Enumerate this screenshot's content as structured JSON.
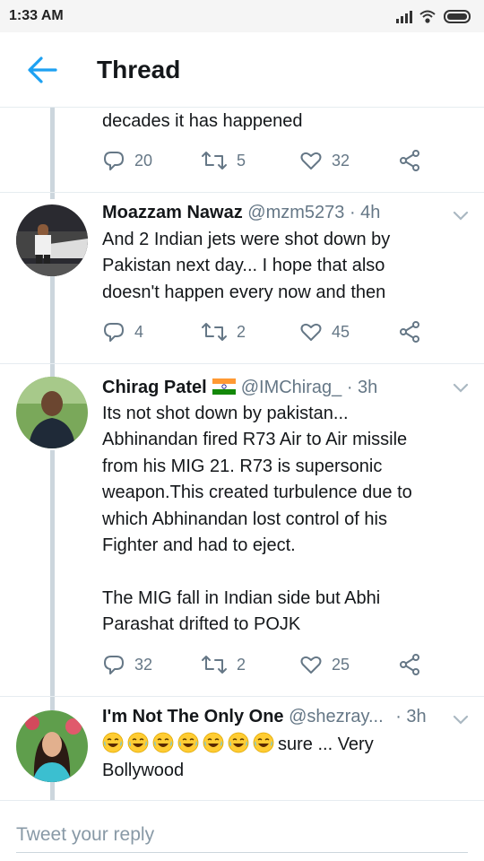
{
  "status_bar": {
    "time": "1:33 AM"
  },
  "header": {
    "title": "Thread"
  },
  "tweets": [
    {
      "text_tail": "decades it has happened",
      "replies": "20",
      "retweets": "5",
      "likes": "32"
    },
    {
      "name": "Moazzam Nawaz",
      "handle": "@mzm5273",
      "time": "· 4h",
      "lines": [
        "And 2 Indian jets were shot down by",
        "Pakistan next day... I hope that also",
        "doesn't happen every now and then"
      ],
      "replies": "4",
      "retweets": "2",
      "likes": "45"
    },
    {
      "name": "Chirag Patel",
      "handle": "@IMChirag_",
      "time": "· 3h",
      "lines": [
        "Its not shot down by pakistan...",
        "Abhinandan fired R73 Air to Air missile",
        "from his MIG 21. R73 is supersonic",
        "weapon.This created turbulence due to",
        "which Abhinandan lost control of his",
        "Fighter and had to eject.",
        "",
        "The MIG fall in Indian side but Abhi",
        "Parashat drifted to POJK"
      ],
      "replies": "32",
      "retweets": "2",
      "likes": "25"
    },
    {
      "name": "I'm Not The Only One",
      "handle": "@shezray...",
      "time": "· 3h",
      "line1_text": "sure ... Very",
      "line2_text": "Bollywood"
    }
  ],
  "reply": {
    "placeholder": "Tweet your reply"
  },
  "colors": {
    "accent": "#1da1f2",
    "muted": "#657786",
    "line": "#ccd6dd"
  }
}
